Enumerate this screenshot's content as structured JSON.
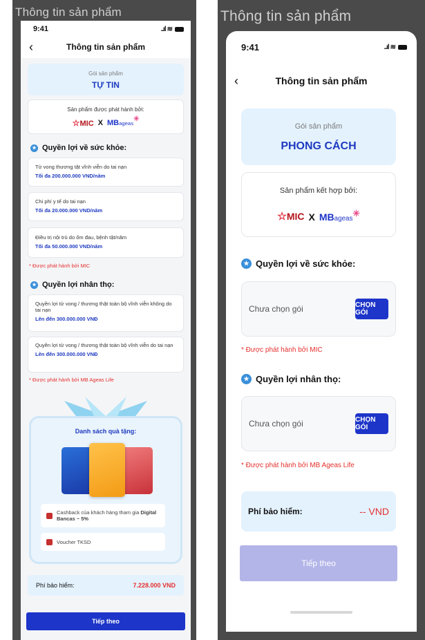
{
  "left": {
    "caption": "Thông tin sản phẩm",
    "status": {
      "time": "9:41",
      "signal": "..ıl",
      "wifi": "≋"
    },
    "nav": {
      "back": "‹",
      "title": "Thông tin sản phẩm"
    },
    "package": {
      "label": "Gói sản phẩm",
      "name": "TỰ TIN"
    },
    "issuer": {
      "label": "Sản phẩm được phát hành bởi:",
      "mic": "MIC",
      "x": "X",
      "mb": "MB",
      "ageas": "ageas"
    },
    "health": {
      "title": "Quyền lợi về sức khỏe:",
      "items": [
        {
          "title": "Tử vong thương tật vĩnh viễn do tai nạn",
          "value": "Tối đa 200.000.000 VND/năm"
        },
        {
          "title": "Chi phí y tế do tai nạn",
          "value": "Tối đa 20.000.000 VND/năm"
        },
        {
          "title": "Điều trị nội trú do ốm đau, bệnh tật/năm",
          "value": "Tối đa 50.000.000 VND/năm"
        }
      ],
      "note": "* Được phát hành bởi MIC"
    },
    "life": {
      "title": "Quyền lợi nhân thọ:",
      "items": [
        {
          "title": "Quyền lợi tử vong / thương thật toàn bộ vĩnh viễn không do tai nạn",
          "value": "Lên đến 300.000.000 VNĐ"
        },
        {
          "title": "Quyền lợi tử vong / thương thật toàn bộ vĩnh viễn do tai nạn",
          "value": "Lên đến 300.000.000 VNĐ"
        }
      ],
      "note": "* Được phát hành bởi MB Ageas Life"
    },
    "gifts": {
      "title": "Danh sách quà tặng:",
      "items": [
        {
          "text": "Cashback của khách hàng tham gia ",
          "bold": "Digital Bancas ~ 5%"
        },
        {
          "text": "Voucher TKSD",
          "bold": ""
        }
      ]
    },
    "fee": {
      "label": "Phí bảo hiểm:",
      "amount": "7.228.000 VND"
    },
    "cta": "Tiếp theo"
  },
  "right": {
    "caption": "Thông tin sản phẩm",
    "status": {
      "time": "9:41",
      "signal": "..ıl",
      "wifi": "≋"
    },
    "nav": {
      "back": "‹",
      "title": "Thông tin sản phẩm"
    },
    "package": {
      "label": "Gói sản phẩm",
      "name": "PHONG CÁCH"
    },
    "issuer": {
      "label": "Sản phẩm kết hợp bởi:",
      "mic": "MIC",
      "x": "X",
      "mb": "MB",
      "ageas": "ageas"
    },
    "health": {
      "title": "Quyền lợi về sức khỏe:",
      "placeholder": "Chưa chọn gói",
      "button": "CHỌN GÓI",
      "note": "* Được phát hành bởi MIC"
    },
    "life": {
      "title": "Quyền lợi nhân thọ:",
      "placeholder": "Chưa chọn gói",
      "button": "CHỌN GÓI",
      "note": "* Được phát hành bởi MB Ageas Life"
    },
    "fee": {
      "label": "Phí bảo hiểm:",
      "amount": "-- VND"
    },
    "cta": "Tiếp theo"
  },
  "colors": {
    "primary": "#1d35c9",
    "accent_red": "#e5302e",
    "package_bg": "#e4f2fd",
    "cta_disabled": "#b3b5e8"
  }
}
